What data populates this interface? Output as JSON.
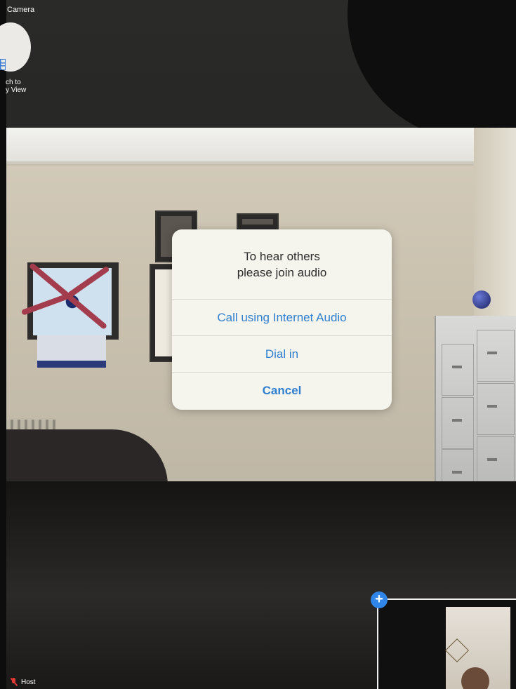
{
  "top_controls": {
    "camera_label": "Camera",
    "switch_view_label_line1": "ch to",
    "switch_view_label_line2": "y View",
    "switch_view_icon": "grid-icon"
  },
  "dialog": {
    "message_line1": "To hear others",
    "message_line2": "please join audio",
    "options": [
      {
        "label": "Call using Internet Audio"
      },
      {
        "label": "Dial in"
      },
      {
        "label": "Cancel"
      }
    ],
    "accent_color": "#2f7fd0"
  },
  "self_preview": {
    "add_icon": "plus-icon",
    "add_symbol": "+"
  },
  "host_label": {
    "text": "Host",
    "icon": "mic-muted-icon",
    "icon_color": "#e53935"
  }
}
